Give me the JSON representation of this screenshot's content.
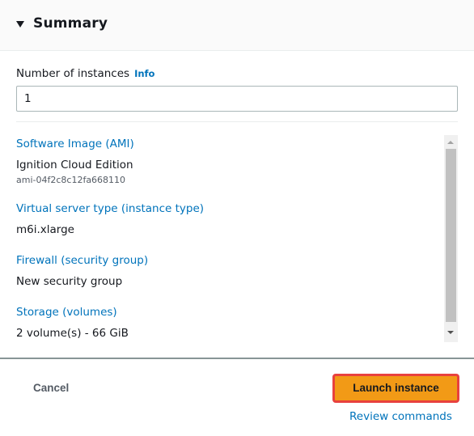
{
  "header": {
    "title": "Summary",
    "expand_icon": "caret-down-icon"
  },
  "instances": {
    "label": "Number of instances",
    "info_link": "Info",
    "value": "1"
  },
  "details": [
    {
      "label": "Software Image (AMI)",
      "value": "Ignition Cloud Edition",
      "sub": "ami-04f2c8c12fa668110"
    },
    {
      "label": "Virtual server type (instance type)",
      "value": "m6i.xlarge"
    },
    {
      "label": "Firewall (security group)",
      "value": "New security group"
    },
    {
      "label": "Storage (volumes)",
      "value": "2 volume(s) - 66 GiB"
    }
  ],
  "footer": {
    "cancel_label": "Cancel",
    "launch_label": "Launch instance",
    "review_label": "Review commands"
  },
  "colors": {
    "link": "#0073bb",
    "primary_button": "#f29a16",
    "highlight_border": "#e8413e"
  }
}
